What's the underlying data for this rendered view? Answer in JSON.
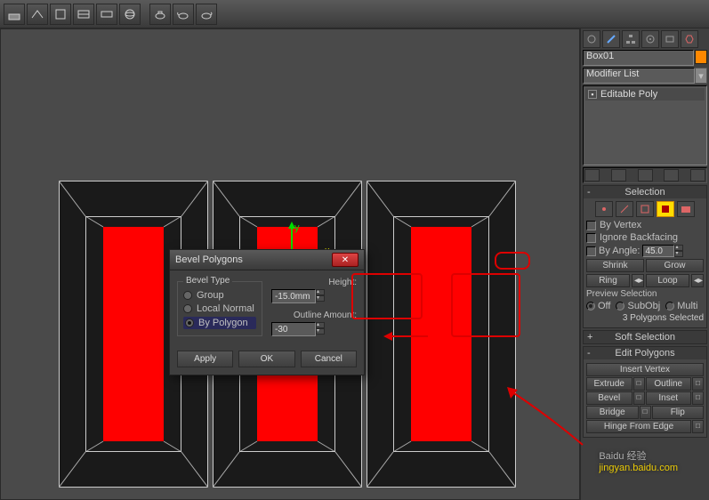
{
  "object_name": "Box01",
  "modifier_list_label": "Modifier List",
  "modifier_stack": {
    "item": "Editable Poly"
  },
  "rollouts": {
    "selection": {
      "title": "Selection",
      "by_vertex": "By Vertex",
      "ignore_backfacing": "Ignore Backfacing",
      "by_angle": "By Angle:",
      "angle_value": "45.0",
      "shrink": "Shrink",
      "grow": "Grow",
      "ring": "Ring",
      "loop": "Loop",
      "preview_label": "Preview Selection",
      "preview_off": "Off",
      "preview_subobj": "SubObj",
      "preview_multi": "Multi",
      "status": "3 Polygons Selected"
    },
    "soft_selection": {
      "title": "Soft Selection"
    },
    "edit_polygons": {
      "title": "Edit Polygons",
      "insert_vertex": "Insert Vertex",
      "extrude": "Extrude",
      "outline": "Outline",
      "bevel": "Bevel",
      "inset": "Inset",
      "bridge": "Bridge",
      "flip": "Flip",
      "hinge_from_edge": "Hinge From Edge"
    }
  },
  "dialog": {
    "title": "Bevel Polygons",
    "bevel_type_label": "Bevel Type",
    "group": "Group",
    "local_normal": "Local Normal",
    "by_polygon": "By Polygon",
    "height_label": "Height:",
    "height_value": "-15.0mm",
    "outline_label": "Outline Amount:",
    "outline_value": "-30",
    "apply": "Apply",
    "ok": "OK",
    "cancel": "Cancel"
  },
  "watermark": {
    "brand": "Baidu 经验",
    "url": "jingyan.baidu.com"
  },
  "chart_data": null
}
